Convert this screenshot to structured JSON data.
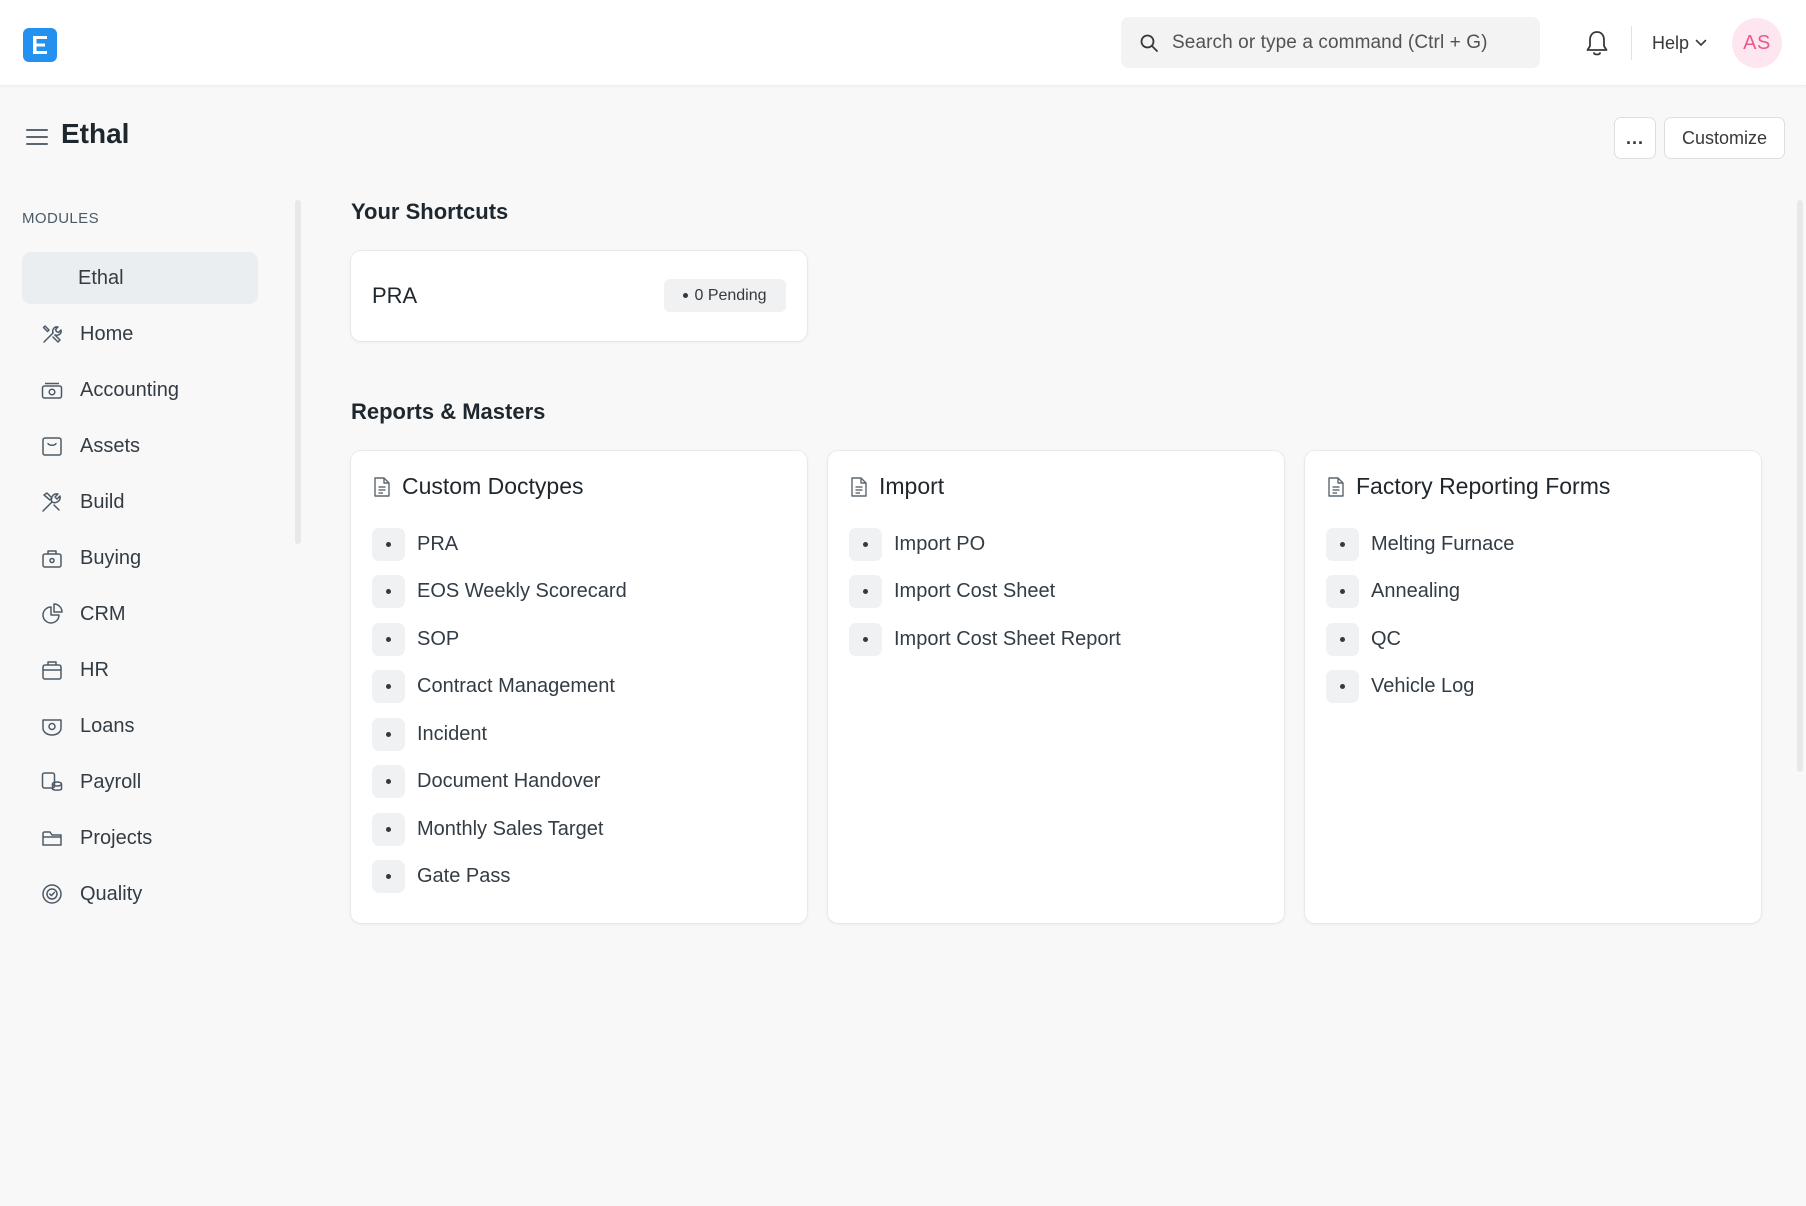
{
  "navbar": {
    "logo_letter": "E",
    "search_placeholder": "Search or type a command (Ctrl + G)",
    "help_label": "Help",
    "avatar_initials": "AS"
  },
  "page": {
    "title": "Ethal",
    "more_label": "...",
    "customize_label": "Customize"
  },
  "sidebar": {
    "heading": "MODULES",
    "items": [
      {
        "label": "Ethal",
        "icon": "none",
        "active": true
      },
      {
        "label": "Home",
        "icon": "tools-icon"
      },
      {
        "label": "Accounting",
        "icon": "money-icon"
      },
      {
        "label": "Assets",
        "icon": "box-icon"
      },
      {
        "label": "Build",
        "icon": "wrench-icon"
      },
      {
        "label": "Buying",
        "icon": "bag-icon"
      },
      {
        "label": "CRM",
        "icon": "pie-icon"
      },
      {
        "label": "HR",
        "icon": "briefcase-icon"
      },
      {
        "label": "Loans",
        "icon": "handshake-icon"
      },
      {
        "label": "Payroll",
        "icon": "coins-icon"
      },
      {
        "label": "Projects",
        "icon": "folder-icon"
      },
      {
        "label": "Quality",
        "icon": "badge-icon"
      }
    ]
  },
  "shortcuts": {
    "title": "Your Shortcuts",
    "items": [
      {
        "label": "PRA",
        "badge": "0 Pending"
      }
    ]
  },
  "reports": {
    "title": "Reports & Masters",
    "cards": [
      {
        "title": "Custom Doctypes",
        "links": [
          "PRA",
          "EOS Weekly Scorecard",
          "SOP",
          "Contract Management",
          "Incident",
          "Document Handover",
          "Monthly Sales Target",
          "Gate Pass"
        ]
      },
      {
        "title": "Import",
        "links": [
          "Import PO",
          "Import Cost Sheet",
          "Import Cost Sheet Report"
        ]
      },
      {
        "title": "Factory Reporting Forms",
        "links": [
          "Melting Furnace",
          "Annealing",
          "QC",
          "Vehicle Log"
        ]
      }
    ]
  },
  "colors": {
    "brand": "#2490ef",
    "avatar_bg": "#fde6ef",
    "avatar_text": "#e85a8e",
    "page_bg": "#f8f8f8"
  }
}
